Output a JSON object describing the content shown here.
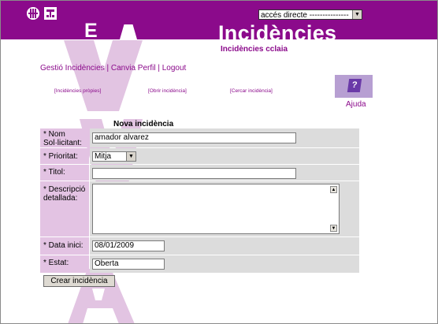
{
  "header": {
    "access_select": "accés directe ---------------",
    "big_letter": "E",
    "title": "Incidències",
    "subtitle": "Incidències cclaia"
  },
  "nav": {
    "links": [
      "Gestió Incidències",
      "Canvia Perfil",
      "Logout"
    ],
    "separator": " | "
  },
  "sublinks": {
    "own": "[Incidències pròpies]",
    "open": "[Obrir incidència]",
    "search": "[Cercar incidència]"
  },
  "help": {
    "label": "Ajuda",
    "icon": "help-question-icon"
  },
  "form": {
    "heading": "Nova incidència",
    "fields": {
      "name": {
        "label_line1": "* Nom",
        "label_line2": "Sol·licitant:",
        "value": "amador alvarez"
      },
      "priority": {
        "label": "* Prioritat:",
        "value": "Mitja"
      },
      "title": {
        "label": "* Titol:",
        "value": ""
      },
      "description": {
        "label_line1": "* Descripció",
        "label_line2": "detallada:",
        "value": ""
      },
      "start_date": {
        "label": "* Data inici:",
        "value": "08/01/2009"
      },
      "state": {
        "label": "* Estat:",
        "value": "Oberta"
      }
    },
    "submit": "Crear incidència"
  },
  "colors": {
    "brand": "#8b0a8b",
    "label_bg": "#e3c3e3",
    "field_bg": "#dcdcdc",
    "watermark": "#e2c4e2"
  }
}
